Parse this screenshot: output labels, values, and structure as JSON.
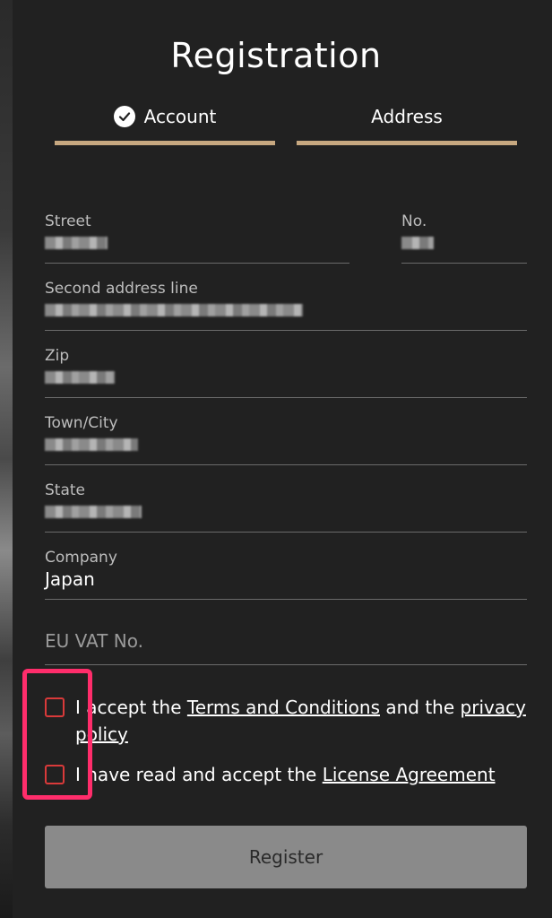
{
  "title": "Registration",
  "steps": [
    {
      "label": "Account",
      "completed": true,
      "icon": "check-icon"
    },
    {
      "label": "Address",
      "completed": false
    }
  ],
  "colors": {
    "accent_bar": "#c7a880",
    "checkbox_border": "#d93a3a",
    "highlight": "#ff2d6b",
    "button_bg": "#8a8a8a"
  },
  "fields": {
    "street": {
      "label": "Street"
    },
    "number": {
      "label": "No."
    },
    "second_address": {
      "label": "Second address line"
    },
    "zip": {
      "label": "Zip"
    },
    "town": {
      "label": "Town/City"
    },
    "state": {
      "label": "State"
    },
    "company": {
      "label": "Company",
      "value": "Japan"
    },
    "vat": {
      "placeholder": "EU VAT No."
    }
  },
  "agreements": {
    "terms": {
      "prefix": "I accept the",
      "link1": "Terms and Conditions",
      "middle": "and the",
      "link2": "privacy policy"
    },
    "license": {
      "prefix": "I have read and accept the",
      "link": "License Agreement"
    }
  },
  "register_label": "Register"
}
